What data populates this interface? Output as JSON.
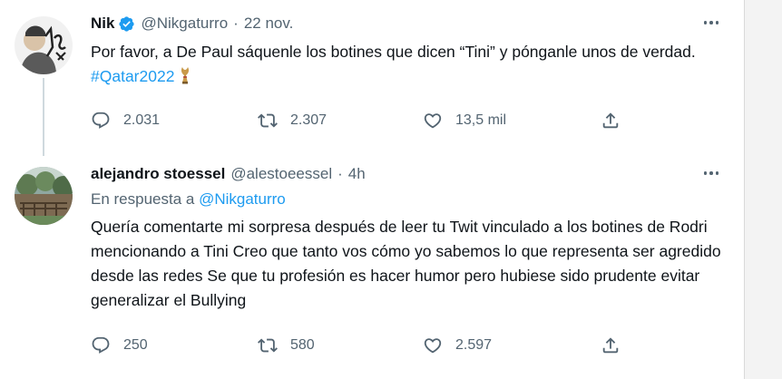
{
  "tweets": [
    {
      "name": "Nik",
      "verified": true,
      "handle": "@Nikgaturro",
      "separator": "·",
      "time": "22 nov.",
      "text": "Por favor, a De Paul sáquenle los botines que dicen “Tini” y pónganle unos de verdad. ",
      "hashtag": "#Qatar2022",
      "emoji_icon": "world-cup-trophy-icon",
      "replies": "2.031",
      "retweets": "2.307",
      "likes": "13,5 mil"
    },
    {
      "name": "alejandro stoessel",
      "verified": false,
      "handle": "@alestoeessel",
      "separator": "·",
      "time": "4h",
      "reply_prefix": "En respuesta a ",
      "reply_to": "@Nikgaturro",
      "text": "Quería comentarte mi sorpresa después de leer tu Twit vinculado a los botines de Rodri mencionando a Tini Creo que tanto vos cómo yo sabemos lo que representa ser agredido desde las redes Se que tu profesión es hacer humor pero hubiese sido prudente evitar generalizar el Bullying",
      "replies": "250",
      "retweets": "580",
      "likes": "2.597"
    }
  ],
  "colors": {
    "text": "#0f1419",
    "secondary": "#536471",
    "link": "#1d9bf0",
    "verified": "#1d9bf0",
    "thread_line": "#cfd9de"
  },
  "icons": [
    "reply-icon",
    "retweet-icon",
    "like-icon",
    "share-icon",
    "more-icon",
    "verified-badge-icon"
  ]
}
